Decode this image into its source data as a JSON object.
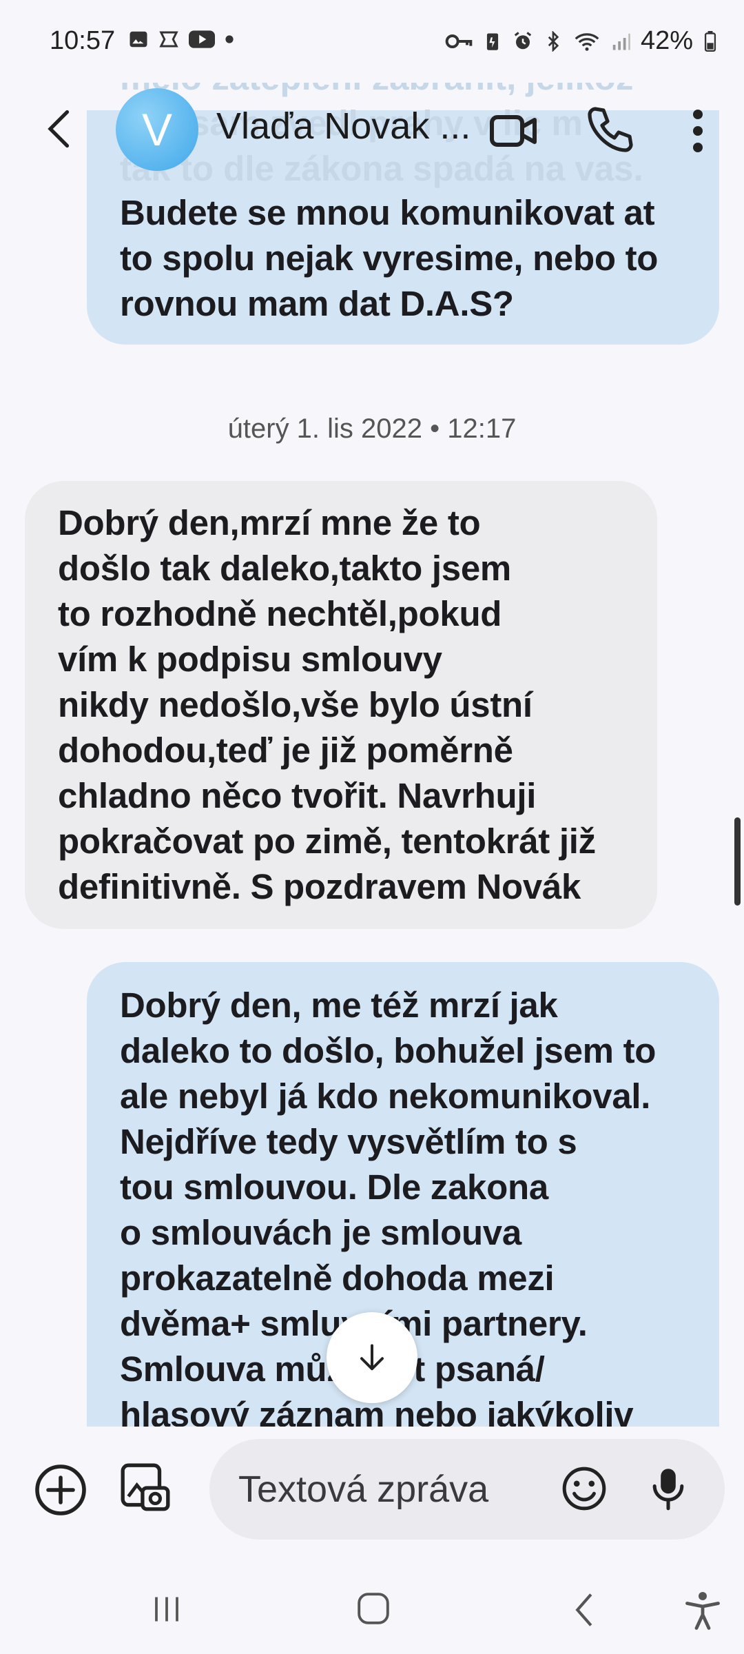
{
  "status_bar": {
    "time": "10:57",
    "battery": "42%",
    "left_icons": [
      "gallery-icon",
      "messenger-icon",
      "youtube-icon",
      "dot-icon"
    ],
    "right_icons": [
      "key-icon",
      "battery-saver-icon",
      "alarm-icon",
      "bluetooth-icon",
      "wifi-icon",
      "signal-icon",
      "battery-icon"
    ]
  },
  "header": {
    "avatar_letter": "V",
    "contact_name": "Vlaďa Novak ...",
    "icons": [
      "back-icon",
      "video-call-icon",
      "phone-icon",
      "more-icon"
    ]
  },
  "conversation": {
    "ghost_lines": [
      "melo zatepleni zabranit, jelikoz",
      "jste sam zvedl prahy v lic m",
      "tak to dle zákona spadá na vas."
    ],
    "messages": [
      {
        "type": "sent",
        "lines": [
          "Budete se mnou komunikovat at",
          "to spolu nejak vyresime, nebo to",
          "rovnou mam dat D.A.S?"
        ]
      },
      {
        "type": "date",
        "text": "úterý 1. lis 2022 • 12:17"
      },
      {
        "type": "received",
        "lines": [
          "Dobrý den,mrzí mne že to",
          "došlo tak daleko,takto jsem",
          "to rozhodně nechtěl,pokud",
          "vím k podpisu smlouvy",
          "nikdy nedošlo,vše bylo ústní",
          "dohodou,teď je již poměrně",
          "chladno něco tvořit. Navrhuji",
          "pokračovat po zimě, tentokrát již",
          "definitivně. S pozdravem Novák"
        ]
      },
      {
        "type": "sent",
        "lines": [
          "Dobrý den, me též mrzí jak",
          "daleko to došlo, bohužel jsem to",
          "ale nebyl já kdo nekomunikoval.",
          "Nejdříve tedy vysvětlím to s",
          "tou smlouvou.  Dle zakona",
          "o smlouvách je smlouva",
          "prokazatelně dohoda mezi",
          "dvěma+ smluvními partnery.",
          "Smlouva může být psaná/",
          "hlasový záznam nebo jakýkoliv"
        ]
      }
    ]
  },
  "composer": {
    "placeholder": "Textová zpráva",
    "icons": [
      "add-icon",
      "gallery-camera-icon",
      "emoji-icon",
      "mic-icon"
    ]
  },
  "navbar": {
    "icons": [
      "recents-icon",
      "home-icon",
      "back-nav-icon",
      "accessibility-icon"
    ]
  }
}
